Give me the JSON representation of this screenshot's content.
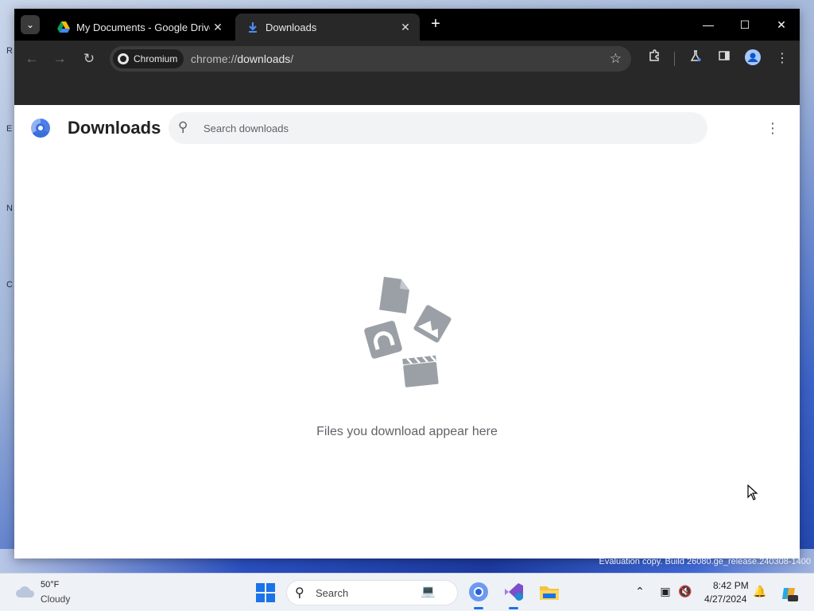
{
  "desktop": {
    "edge_letters": [
      "R",
      "E",
      "N",
      "C"
    ],
    "watermark": "Evaluation copy. Build 26080.ge_release.240308-1400"
  },
  "browser": {
    "tabs": [
      {
        "title": "My Documents - Google Drive",
        "icon": "google-drive-icon",
        "active": false
      },
      {
        "title": "Downloads",
        "icon": "download-icon",
        "active": true
      }
    ],
    "omnibox": {
      "chip_label": "Chromium",
      "url_scheme": "chrome://",
      "url_host": "downloads",
      "url_suffix": "/"
    }
  },
  "page": {
    "title": "Downloads",
    "search": {
      "placeholder": "Search downloads",
      "value": ""
    },
    "empty_message": "Files you download appear here"
  },
  "taskbar": {
    "weather": {
      "temperature": "50°F",
      "condition": "Cloudy"
    },
    "search_label": "Search",
    "apps": [
      "chromium",
      "visual-studio",
      "file-explorer"
    ],
    "clock": {
      "time": "8:42 PM",
      "date": "4/27/2024"
    }
  },
  "colors": {
    "accent": "#1a73e8",
    "tabstrip": "#000000",
    "toolbar": "#282828",
    "empty_art": "#9aa0a6"
  }
}
